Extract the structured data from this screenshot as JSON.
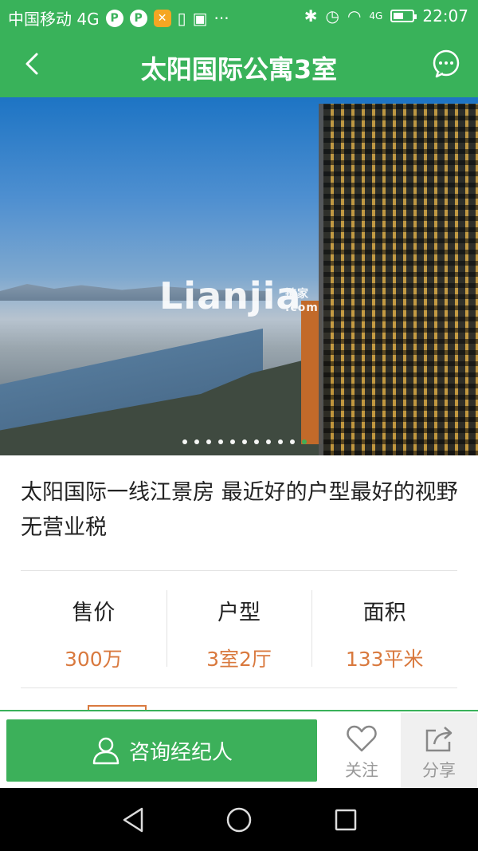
{
  "status_bar": {
    "carrier": "中国移动 4G",
    "time": "22:07",
    "network": "4G",
    "icons": [
      "p-icon",
      "p-icon",
      "app-icon",
      "battery-saver-icon",
      "image-icon",
      "more-icon",
      "bluetooth-icon",
      "alarm-icon",
      "wifi-icon",
      "signal-icon",
      "battery-icon"
    ]
  },
  "header": {
    "title": "太阳国际公寓3室",
    "back_icon": "chevron-left-icon",
    "chat_icon": "chat-bubble-icon",
    "accent_color": "#39b25a"
  },
  "gallery": {
    "watermark": "Lianjia",
    "watermark_cn": "链家",
    "watermark_domain": ".com",
    "total_images": 11,
    "active_index": 11
  },
  "listing": {
    "headline": "太阳国际一线江景房 最近好的户型最好的视野无营业税"
  },
  "stats": [
    {
      "label": "售价",
      "value": "300万"
    },
    {
      "label": "户型",
      "value": "3室2厅"
    },
    {
      "label": "面积",
      "value": "133平米"
    }
  ],
  "actions": {
    "consult_label": "咨询经纪人",
    "follow_label": "关注",
    "share_label": "分享",
    "value_color": "#d9793e"
  }
}
